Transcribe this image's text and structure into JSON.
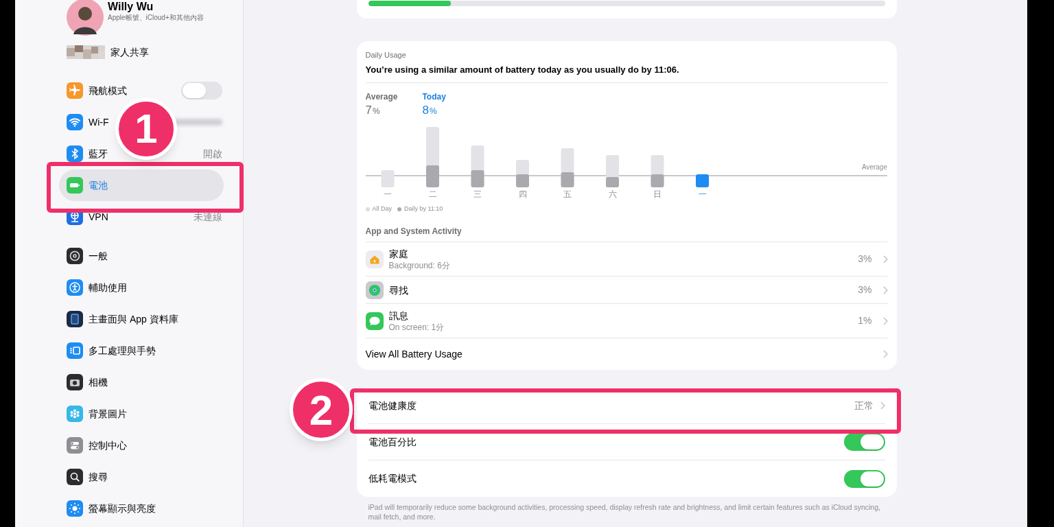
{
  "top_card": {
    "progress": {
      "level": 0.16
    }
  },
  "sidebar": {
    "profile": {
      "name": "Willy Wu",
      "subtitle": "Apple帳號、iCloud+和其他內容"
    },
    "family": {
      "label": "家人共享"
    },
    "groups": [
      [
        {
          "label": "飛航模式",
          "kind": "toggle",
          "on": false,
          "selected": false
        },
        {
          "label": "Wi-F",
          "kind": "redacted",
          "selected": false
        },
        {
          "label": "藍牙",
          "kind": "value",
          "value": "開啟",
          "selected": false
        },
        {
          "label": "電池",
          "kind": "plain",
          "selected": true
        },
        {
          "label": "VPN",
          "kind": "value",
          "value": "未連線",
          "selected": false
        }
      ],
      [
        {
          "label": "一般",
          "kind": "plain",
          "selected": false
        },
        {
          "label": "輔助使用",
          "kind": "plain",
          "selected": false
        },
        {
          "label": "主畫面與 App 資料庫",
          "kind": "plain",
          "selected": false
        },
        {
          "label": "多工處理與手勢",
          "kind": "plain",
          "selected": false
        },
        {
          "label": "相機",
          "kind": "plain",
          "selected": false
        },
        {
          "label": "背景圖片",
          "kind": "plain",
          "selected": false
        },
        {
          "label": "控制中心",
          "kind": "plain",
          "selected": false
        },
        {
          "label": "搜尋",
          "kind": "plain",
          "selected": false
        },
        {
          "label": "螢幕顯示與亮度",
          "kind": "plain",
          "selected": false
        }
      ]
    ]
  },
  "daily_usage": {
    "heading": "Daily Usage",
    "message": "You’re using a similar amount of battery today as you usually do by 11:06.",
    "stats": [
      {
        "label": "Average",
        "value": "7",
        "unit": "%",
        "selected": false
      },
      {
        "label": "Today",
        "value": "8",
        "unit": "%",
        "selected": true
      }
    ],
    "average_label": "Average",
    "days": [
      {
        "label": "一",
        "selected": false
      },
      {
        "label": "二",
        "selected": false
      },
      {
        "label": "三",
        "selected": false
      },
      {
        "label": "四",
        "selected": false
      },
      {
        "label": "五",
        "selected": false
      },
      {
        "label": "六",
        "selected": false
      },
      {
        "label": "日",
        "selected": false
      },
      {
        "label": "一",
        "selected": true
      }
    ],
    "legend": [
      {
        "label": "All Day",
        "color": "#dcdce0"
      },
      {
        "label": "Daily by 11:10",
        "color": "#a9a9ae"
      }
    ],
    "activity_heading": "App and System Activity",
    "apps": [
      {
        "name": "家庭",
        "detail": "Background: 6分",
        "percent": "3%"
      },
      {
        "name": "尋找",
        "percent": "3%"
      },
      {
        "name": "訊息",
        "detail": "On screen: 1分",
        "percent": "1%"
      }
    ],
    "view_all": "View All Battery Usage"
  },
  "settings": [
    {
      "label": "電池健康度",
      "kind": "link",
      "value": "正常"
    },
    {
      "label": "電池百分比",
      "kind": "toggle",
      "on": true
    },
    {
      "label": "低耗電模式",
      "kind": "toggle",
      "on": true
    }
  ],
  "footnote": "iPad will temporarily reduce some background activities, processing speed, display refresh rate and brightness, and limit certain features such as iCloud syncing, mail fetch, and more.",
  "annotations": [
    {
      "number": "1"
    },
    {
      "number": "2"
    }
  ]
}
